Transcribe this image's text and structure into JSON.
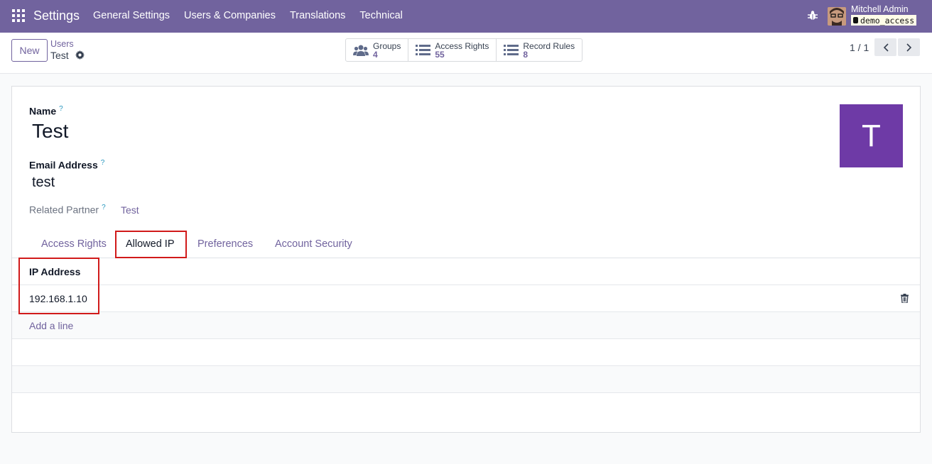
{
  "navbar": {
    "brand": "Settings",
    "menu": [
      "General Settings",
      "Users & Companies",
      "Translations",
      "Technical"
    ],
    "user_name": "Mitchell Admin",
    "database": "demo_access",
    "color": "#71639e"
  },
  "control_panel": {
    "new_label": "New",
    "breadcrumb_parent": "Users",
    "breadcrumb_current": "Test",
    "stats": [
      {
        "label": "Groups",
        "value": "4",
        "icon": "users-icon"
      },
      {
        "label": "Access Rights",
        "value": "55",
        "icon": "list-icon"
      },
      {
        "label": "Record Rules",
        "value": "8",
        "icon": "list-icon"
      }
    ],
    "pager": "1 / 1"
  },
  "form": {
    "name_label": "Name",
    "name_value": "Test",
    "email_label": "Email Address",
    "email_value": "test",
    "partner_label": "Related Partner",
    "partner_value": "Test",
    "help_mark": "?",
    "avatar_letter": "T",
    "avatar_color": "#6e3aa6",
    "tabs": [
      "Access Rights",
      "Allowed IP",
      "Preferences",
      "Account Security"
    ],
    "active_tab": "Allowed IP",
    "ip_table": {
      "header": "IP Address",
      "rows": [
        "192.168.1.10"
      ],
      "add_line": "Add a line"
    }
  }
}
